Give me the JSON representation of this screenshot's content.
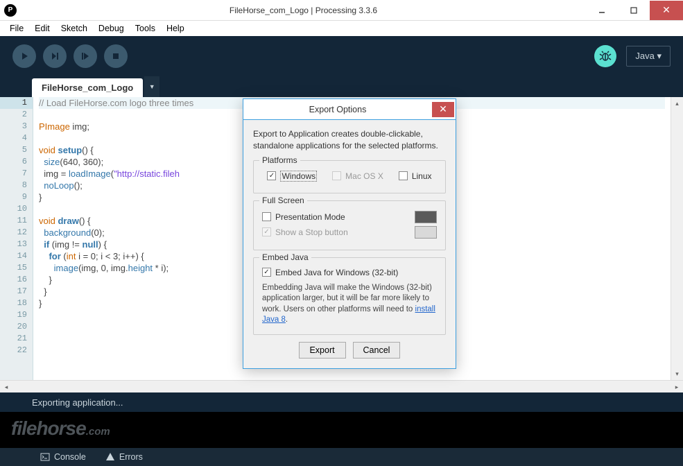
{
  "window": {
    "title": "FileHorse_com_Logo | Processing 3.3.6",
    "icon_letter": "P"
  },
  "menubar": [
    "File",
    "Edit",
    "Sketch",
    "Debug",
    "Tools",
    "Help"
  ],
  "toolbar": {
    "mode_label": "Java ▾"
  },
  "tab": {
    "name": "FileHorse_com_Logo"
  },
  "code_lines": [
    {
      "n": 1,
      "cls": "current",
      "html": "<span class='comment'>// Load FileHorse.com logo three times</span>"
    },
    {
      "n": 2,
      "html": ""
    },
    {
      "n": 3,
      "html": "<span class='type'>PImage</span> img;"
    },
    {
      "n": 4,
      "html": ""
    },
    {
      "n": 5,
      "html": "<span class='type'>void</span> <span class='kw'>setup</span>() {"
    },
    {
      "n": 6,
      "html": "  <span class='fn'>size</span>(640, 360);"
    },
    {
      "n": 7,
      "html": "  img = <span class='fn'>loadImage</span>(<span class='str'>\"http://static.fileh</span>"
    },
    {
      "n": 8,
      "html": "  <span class='fn'>noLoop</span>();"
    },
    {
      "n": 9,
      "html": "}"
    },
    {
      "n": 10,
      "html": ""
    },
    {
      "n": 11,
      "html": "<span class='type'>void</span> <span class='kw'>draw</span>() {"
    },
    {
      "n": 12,
      "html": "  <span class='fn'>background</span>(0);"
    },
    {
      "n": 13,
      "html": "  <span class='kw'>if</span> (img != <span class='kw'>null</span>) {"
    },
    {
      "n": 14,
      "html": "    <span class='kw'>for</span> (<span class='type'>int</span> i = 0; i &lt; 3; i++) {"
    },
    {
      "n": 15,
      "html": "      <span class='fn'>image</span>(img, 0, img.<span class='fn'>height</span> * i);"
    },
    {
      "n": 16,
      "html": "    }"
    },
    {
      "n": 17,
      "html": "  }"
    },
    {
      "n": 18,
      "html": "}"
    },
    {
      "n": 19,
      "html": ""
    },
    {
      "n": 20,
      "html": ""
    },
    {
      "n": 21,
      "html": ""
    },
    {
      "n": 22,
      "html": ""
    }
  ],
  "status": {
    "text": "Exporting application..."
  },
  "console_tabs": {
    "console": "Console",
    "errors": "Errors"
  },
  "dialog": {
    "title": "Export Options",
    "description": "Export to Application creates double-clickable, standalone applications for the selected platforms.",
    "platforms": {
      "legend": "Platforms",
      "windows": "Windows",
      "macosx": "Mac OS X",
      "linux": "Linux"
    },
    "fullscreen": {
      "legend": "Full Screen",
      "presentation": "Presentation Mode",
      "stopbutton": "Show a Stop button",
      "color_present": "#5a5a5a",
      "color_stop": "#d9d9d9"
    },
    "embed": {
      "legend": "Embed Java",
      "check_label": "Embed Java for Windows (32-bit)",
      "note_pre": "Embedding Java will make the Windows (32-bit) application larger, but it will be far more likely to work. Users on other platforms will need to ",
      "note_link": "install Java 8",
      "note_post": "."
    },
    "buttons": {
      "export": "Export",
      "cancel": "Cancel"
    }
  },
  "watermark": {
    "brand": "filehorse",
    "tld": ".com"
  }
}
